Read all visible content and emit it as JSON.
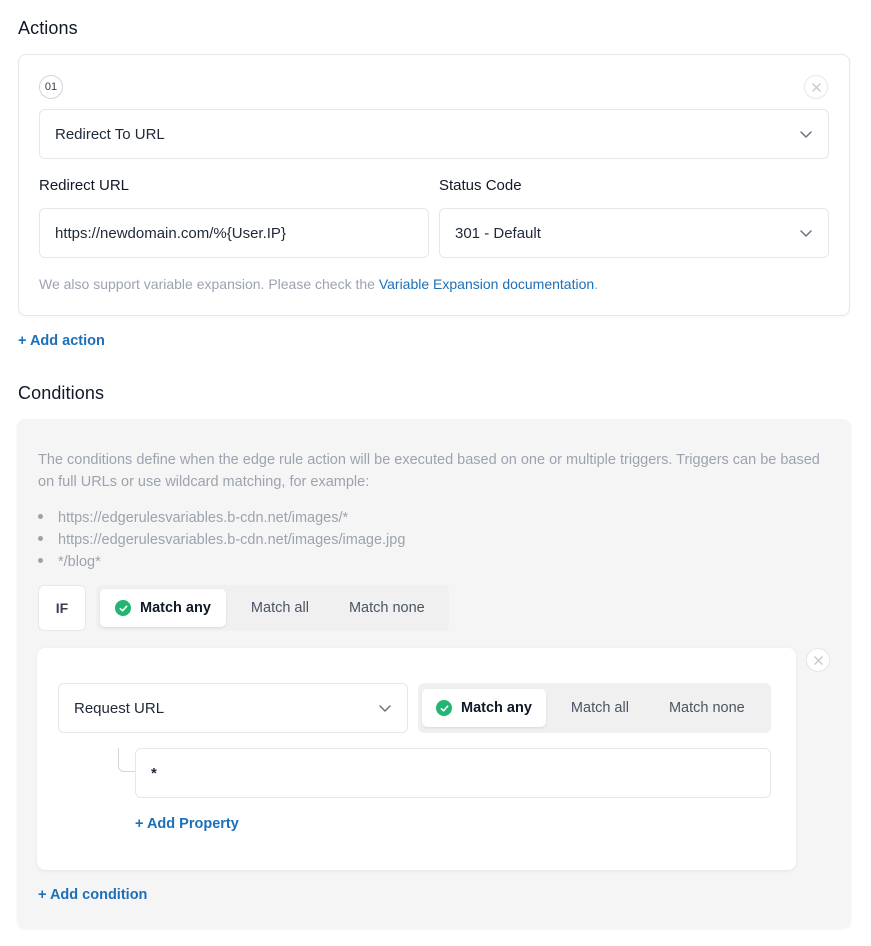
{
  "actions": {
    "title": "Actions",
    "card": {
      "number": "01",
      "action_type": "Redirect To URL",
      "redirect_url_label": "Redirect URL",
      "redirect_url_value": "https://newdomain.com/%{User.IP}",
      "status_code_label": "Status Code",
      "status_code_value": "301 - Default",
      "hint_prefix": "We also support variable expansion. Please check the ",
      "hint_link": "Variable Expansion documentation",
      "hint_suffix": "."
    },
    "add_action": "+ Add action"
  },
  "conditions": {
    "title": "Conditions",
    "description": "The conditions define when the edge rule action will be executed based on one or multiple triggers. Triggers can be based on full URLs or use wildcard matching, for example:",
    "examples": [
      "https://edgerulesvariables.b-cdn.net/images/*",
      "https://edgerulesvariables.b-cdn.net/images/image.jpg",
      "*/blog*"
    ],
    "if_label": "IF",
    "match_options": [
      "Match any",
      "Match all",
      "Match none"
    ],
    "selected_match": "Match any",
    "condition": {
      "property": "Request URL",
      "match_options": [
        "Match any",
        "Match all",
        "Match none"
      ],
      "selected_match": "Match any",
      "value": "*",
      "add_property": "+ Add Property"
    },
    "add_condition": "+ Add condition"
  },
  "colors": {
    "accent_link": "#1d6fb8",
    "check_green": "#22b573",
    "panel_bg": "#f5f5f5"
  },
  "icons": [
    "close-icon",
    "chevron-down-icon",
    "check-icon"
  ]
}
